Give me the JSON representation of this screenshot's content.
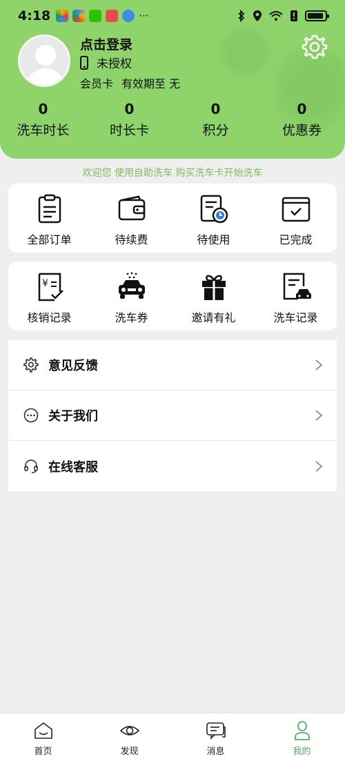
{
  "status": {
    "time": "4:18",
    "apps": [
      "colorful-app-icon",
      "colorful-app-icon",
      "wechat-icon",
      "red-app-icon",
      "browser-icon"
    ],
    "more": "···"
  },
  "profile": {
    "login_title": "点击登录",
    "auth_status": "未授权",
    "member_card_label": "会员卡",
    "validity_label": "有效期至",
    "validity_value": "无"
  },
  "stats": [
    {
      "value": "0",
      "label": "洗车时长"
    },
    {
      "value": "0",
      "label": "时长卡"
    },
    {
      "value": "0",
      "label": "积分"
    },
    {
      "value": "0",
      "label": "优惠券"
    }
  ],
  "welcome_text": "欢迎您 使用自助洗车 购买洗车卡开始洗车",
  "orders": [
    {
      "label": "全部订单",
      "icon": "clipboard-icon"
    },
    {
      "label": "待续费",
      "icon": "wallet-icon"
    },
    {
      "label": "待使用",
      "icon": "pending-doc-icon"
    },
    {
      "label": "已完成",
      "icon": "completed-icon"
    }
  ],
  "services": [
    {
      "label": "核销记录",
      "icon": "receipt-icon"
    },
    {
      "label": "洗车券",
      "icon": "car-wash-icon"
    },
    {
      "label": "邀请有礼",
      "icon": "gift-icon"
    },
    {
      "label": "洗车记录",
      "icon": "car-record-icon"
    }
  ],
  "menu": [
    {
      "label": "意见反馈",
      "icon": "gear-icon"
    },
    {
      "label": "关于我们",
      "icon": "more-circle-icon"
    },
    {
      "label": "在线客服",
      "icon": "headset-icon"
    }
  ],
  "tabs": [
    {
      "label": "首页",
      "icon": "home-icon",
      "active": false
    },
    {
      "label": "发现",
      "icon": "eye-icon",
      "active": false
    },
    {
      "label": "消息",
      "icon": "message-icon",
      "active": false
    },
    {
      "label": "我的",
      "icon": "user-icon",
      "active": true
    }
  ],
  "colors": {
    "header_bg": "#8fd36b",
    "accent": "#4fb06a",
    "welcome": "#7ebb5b"
  }
}
